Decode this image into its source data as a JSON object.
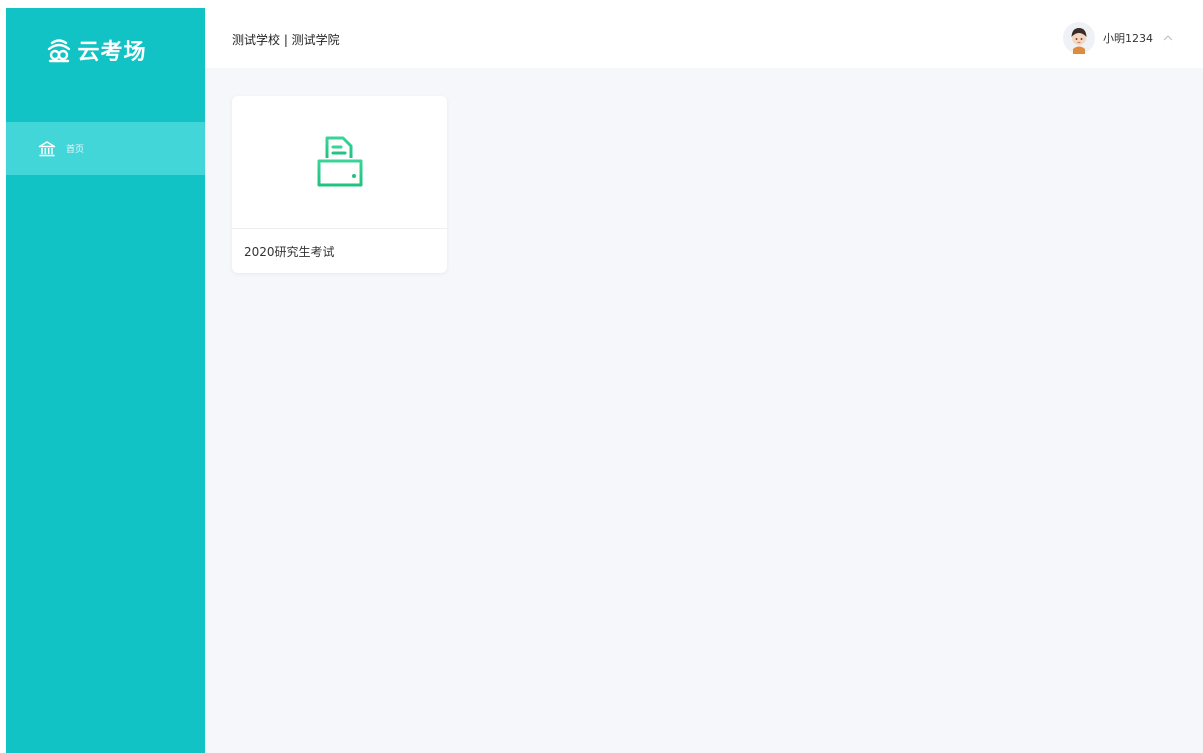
{
  "app": {
    "logo_text": "云考场",
    "brand_color": "#12c3c5",
    "active_color": "#43d6d9",
    "accent_green": "#2ecf8c"
  },
  "sidebar": {
    "items": [
      {
        "label": "首页",
        "icon": "home-bank-icon",
        "active": true
      }
    ]
  },
  "header": {
    "school": "测试学校 | 测试学院",
    "user": {
      "name": "小明1234",
      "avatar_icon": "avatar-boy-icon",
      "caret_icon": "chevron-up-icon"
    }
  },
  "exams": [
    {
      "title": "2020研究生考试",
      "icon": "printer-document-icon"
    }
  ]
}
